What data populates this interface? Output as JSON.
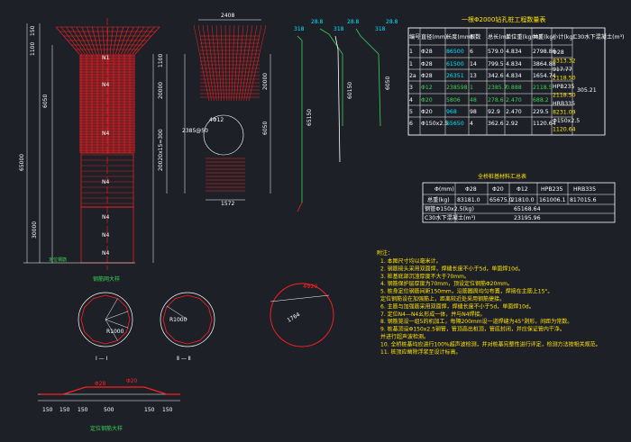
{
  "drawing": {
    "bg_color": "#1e2027",
    "rebar_color": "#ff2020",
    "dim_color": "#ffffff",
    "annot_color": "#00e5ff",
    "note_color": "#ffe400",
    "green_color": "#39d353",
    "elevation": {
      "top_width": "2408",
      "left_dims": [
        "150",
        "1100",
        "6050",
        "12700",
        "65000",
        "30000"
      ],
      "mid_dims": [
        "1100",
        "20000",
        "5900",
        "20020x15=300"
      ],
      "side_dims": [
        "20000",
        "6050",
        "60150"
      ],
      "bar_labels": [
        "N1",
        "N4",
        "N4",
        "N4",
        "N4",
        "N4",
        "N4",
        "N4"
      ],
      "ring_label": "4Φ12",
      "ring_sub": "2385@50",
      "bottom_dim": "1572",
      "angle_label": "70",
      "rebar_tags": [
        "318",
        "28.8",
        "318",
        "28.8",
        "318",
        "28.8"
      ],
      "rebar_lengths": [
        "60150",
        "65150",
        "6050",
        "2985"
      ]
    },
    "main_table": {
      "title": "一根Φ2000钻孔桩工程数量表",
      "headers": [
        "编号",
        "直径(mm)",
        "长度(mm)",
        "根数",
        "总长(m)",
        "单位重(kg/m)",
        "共重(kg)",
        "小计(kg)",
        "C30水下混凝土(m³)"
      ],
      "rows": [
        [
          "1",
          "Φ28",
          "86500",
          "6",
          "579.0",
          "4.834",
          "2798.86"
        ],
        [
          "1",
          "Φ28",
          "61500",
          "14",
          "799.5",
          "4.834",
          "3864.88"
        ],
        [
          "2a",
          "Φ28",
          "26351",
          "13",
          "342.6",
          "4.834",
          "1654.74"
        ],
        [
          "3",
          "Φ12",
          "238598",
          "1",
          "2385.7",
          "0.888",
          "2118.5"
        ],
        [
          "4",
          "Φ20",
          "5806",
          "48",
          "278.6",
          "2.470",
          "688.2"
        ],
        [
          "5",
          "Φ20",
          "968",
          "98",
          "92.9",
          "2.470",
          "229.5"
        ],
        [
          "6",
          "Φ150x2.5",
          "65650",
          "4",
          "362.6",
          "2.92",
          "1120.64"
        ]
      ],
      "subtotals": [
        "Φ28",
        "8313.32",
        "917.77",
        "2118.50",
        "HPB235",
        "2118.50",
        "HRB335",
        "8231.09",
        "Φ150x2.5",
        "1120.64"
      ],
      "concrete": "305.21"
    },
    "summary_table": {
      "title": "全桥桩基材料汇总表",
      "headers": [
        "Φ(mm)",
        "Φ28",
        "Φ20",
        "Φ12",
        "HPB235",
        "HRB335"
      ],
      "row1_label": "总重(kg)",
      "row1": [
        "83181.0",
        "65675.0",
        "21810.0",
        "161006.1",
        "817015.6"
      ],
      "row2_label": "钢管Φ150x2.5(kg)",
      "row2_value": "65168.64",
      "row3_label": "C30水下混凝土(m³)",
      "row3_value": "23195.96"
    },
    "sections": {
      "sec1_label": "Ⅰ — Ⅰ",
      "sec2_label": "Ⅱ — Ⅱ",
      "sec1_dims": [
        "R1000",
        "R1000"
      ],
      "sec2_dims": [
        "R1000"
      ],
      "ring_dim": "1764",
      "ring_tag": "4Φ20",
      "plan_title": "钢筋网大样",
      "mid_title": "定位钢筋",
      "detail_title": "定位钢筋大样",
      "detail_dims": [
        "150",
        "150",
        "150",
        "500",
        "150",
        "150"
      ],
      "detail_tags": [
        "Φ28",
        "Φ20"
      ]
    },
    "notes": {
      "title": "附注：",
      "items": [
        "1. 本图尺寸均以毫米计。",
        "2. 钢筋接头采用双面焊，焊缝长度不小于5d，单面焊10d。",
        "3. 桩基底部沉渣厚度不大于70mm。",
        "4. 钢筋保护层厚度为70mm，顶设定位钢筋Φ20mm。",
        "5. 桩身定位钢筋间距150mm，沿筋圆周均匀布置，焊接在主筋上15°。",
        "   定位钢筋设在加强筋上，距离较近处采用钢筋捷接。",
        "6. 主筋与加强筋采用双面焊，焊缝长度不小于5d，单面焊10d。",
        "7. 定位N4—N4幺形成一体，并与N4焊接。",
        "8. 钢筋笼设一组5的机加工，每隔200mm设一道焊缝为45°剥形，间距为常数。",
        "9. 桩基顶设Φ150x2.5钢管，管顶高出桩顶，管底封闭，并应保证管内干净。",
        "   并进行超声波检测。",
        "10. 全桥桩基均应进行100%超声波检测，并对桩基完整性进行评定，检测方法按相关规范。",
        "11. 桩顶应凿除浮浆至设计标高。"
      ]
    }
  }
}
